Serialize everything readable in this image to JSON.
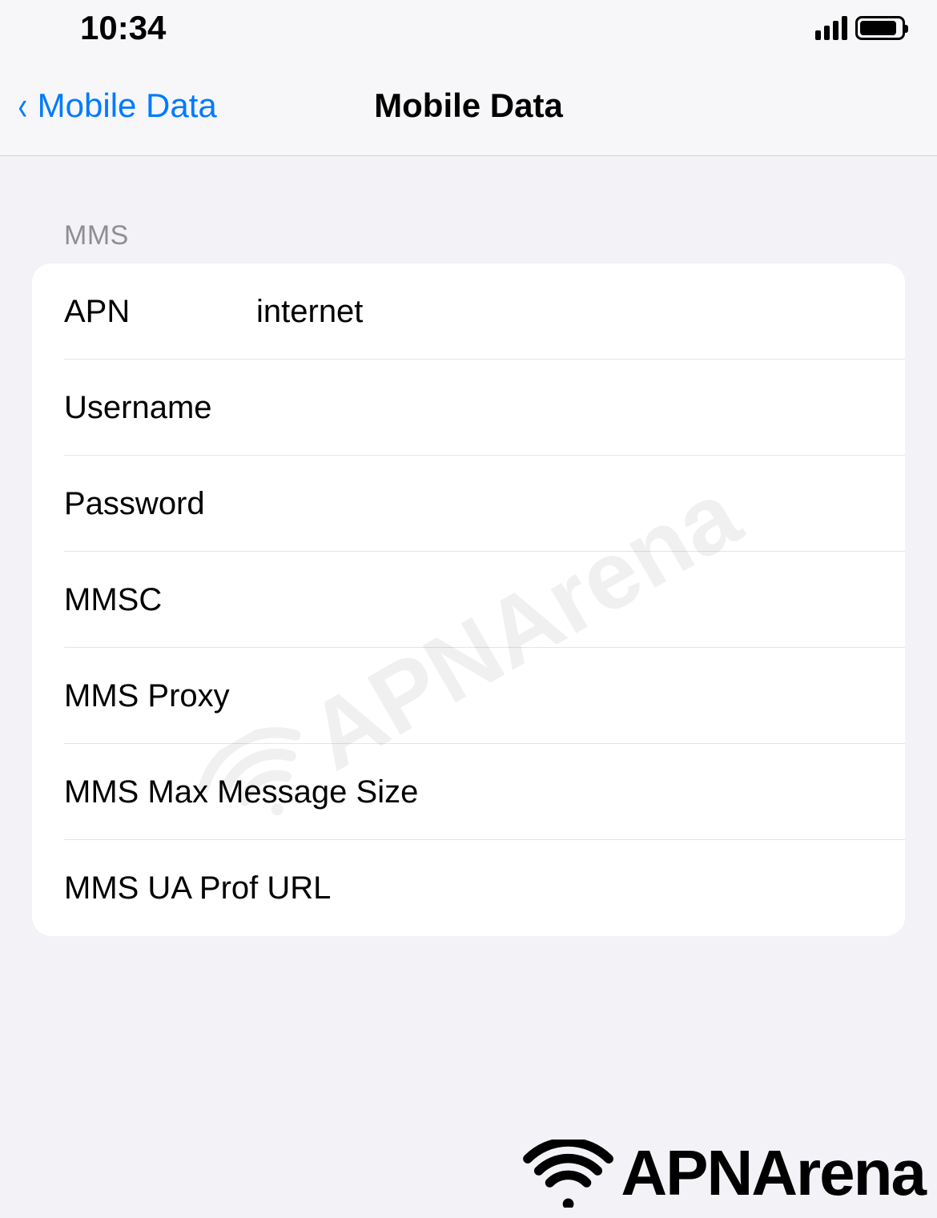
{
  "status_bar": {
    "time": "10:34"
  },
  "nav": {
    "back_label": "Mobile Data",
    "title": "Mobile Data"
  },
  "section_header": "MMS",
  "fields": {
    "apn": {
      "label": "APN",
      "value": "internet"
    },
    "username": {
      "label": "Username",
      "value": ""
    },
    "password": {
      "label": "Password",
      "value": ""
    },
    "mmsc": {
      "label": "MMSC",
      "value": ""
    },
    "mms_proxy": {
      "label": "MMS Proxy",
      "value": ""
    },
    "mms_max_size": {
      "label": "MMS Max Message Size",
      "value": ""
    },
    "mms_ua_prof": {
      "label": "MMS UA Prof URL",
      "value": ""
    }
  },
  "watermark": "APNArena",
  "bottom_logo": "APNArena"
}
